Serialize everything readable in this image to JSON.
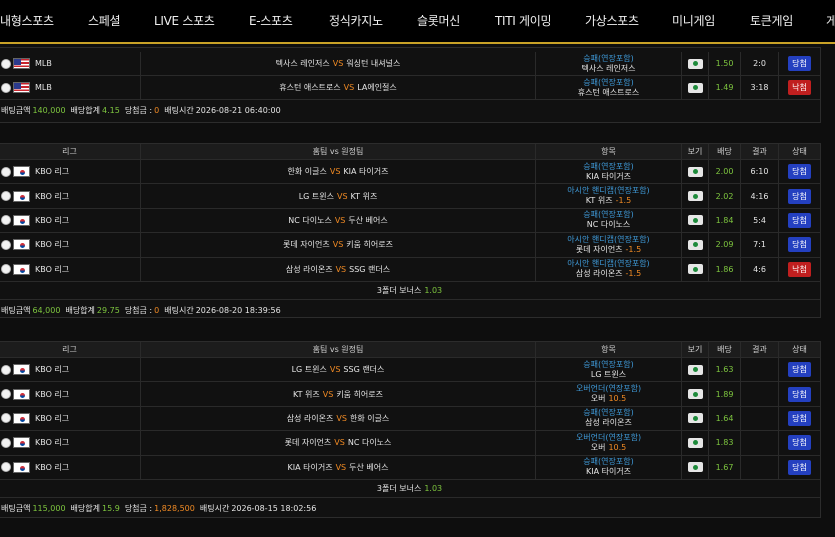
{
  "nav": [
    "내형스포츠",
    "스페셜",
    "LIVE 스포츠",
    "E-스포츠",
    "정식카지노",
    "슬롯머신",
    "TITI 게이밍",
    "가상스포츠",
    "미니게임",
    "토큰게임",
    "게"
  ],
  "labels": {
    "col_league": "리그",
    "col_match": "홈팀 vs 원정팀",
    "col_pick": "항목",
    "col_view": "보기",
    "col_odds": "배당",
    "col_result": "결과",
    "col_status": "상태",
    "vs": "VS",
    "bet_amount": "배팅금액",
    "total_odds": "배당합계",
    "payout": "당첨금 :",
    "bet_time": "배팅시간",
    "bonus": "3폴더 보너스"
  },
  "bets": [
    {
      "rows": [
        {
          "flag": "us",
          "league": "MLB",
          "home": "텍사스 레인저스",
          "away": "워싱턴 내셔널스",
          "pick_top": "승패(연장포함)",
          "pick_hcp": "",
          "pick_bottom": "텍사스 레인저스",
          "odds": "1.50",
          "result": "2:0",
          "status": "당첨",
          "status_type": "win"
        },
        {
          "flag": "us",
          "league": "MLB",
          "home": "휴스턴 애스트로스",
          "away": "LA에인절스",
          "pick_top": "승패(연장포함)",
          "pick_hcp": "",
          "pick_bottom": "휴스턴 애스트로스",
          "odds": "1.49",
          "result": "3:18",
          "status": "낙첨",
          "status_type": "lose"
        }
      ],
      "bet_amount": "140,000",
      "total_odds": "4.15",
      "payout": "0",
      "bet_time": "2026-08-21 06:40:00"
    },
    {
      "rows": [
        {
          "flag": "kr",
          "league": "KBO 리그",
          "home": "한화 이글스",
          "away": "KIA 타이거즈",
          "pick_top": "승패(연장포함)",
          "pick_hcp": "",
          "pick_bottom": "KIA 타이거즈",
          "odds": "2.00",
          "result": "6:10",
          "status": "당첨",
          "status_type": "win"
        },
        {
          "flag": "kr",
          "league": "KBO 리그",
          "home": "LG 트윈스",
          "away": "KT 위즈",
          "pick_top": "아시안 핸디캡(연장포함)",
          "pick_hcp": "-1.5",
          "pick_bottom": "KT 위즈",
          "odds": "2.02",
          "result": "4:16",
          "status": "당첨",
          "status_type": "win"
        },
        {
          "flag": "kr",
          "league": "KBO 리그",
          "home": "NC 다이노스",
          "away": "두산 베어스",
          "pick_top": "승패(연장포함)",
          "pick_hcp": "",
          "pick_bottom": "NC 다이노스",
          "odds": "1.84",
          "result": "5:4",
          "status": "당첨",
          "status_type": "win"
        },
        {
          "flag": "kr",
          "league": "KBO 리그",
          "home": "롯데 자이언츠",
          "away": "키움 히어로즈",
          "pick_top": "아시안 핸디캡(연장포함)",
          "pick_hcp": "-1.5",
          "pick_bottom": "롯데 자이언츠",
          "odds": "2.09",
          "result": "7:1",
          "status": "당첨",
          "status_type": "win"
        },
        {
          "flag": "kr",
          "league": "KBO 리그",
          "home": "삼성 라이온즈",
          "away": "SSG 랜더스",
          "pick_top": "아시안 핸디캡(연장포함)",
          "pick_hcp": "-1.5",
          "pick_bottom": "삼성 라이온즈",
          "odds": "1.86",
          "result": "4:6",
          "status": "낙첨",
          "status_type": "lose"
        }
      ],
      "bonus_value": "1.03",
      "bet_amount": "64,000",
      "total_odds": "29.75",
      "payout": "0",
      "bet_time": "2026-08-20 18:39:56"
    },
    {
      "rows": [
        {
          "flag": "kr",
          "league": "KBO 리그",
          "home": "LG 트윈스",
          "away": "SSG 랜더스",
          "pick_top": "승패(연장포함)",
          "pick_hcp": "",
          "pick_bottom": "LG 트윈스",
          "odds": "1.63",
          "result": "",
          "status": "당첨",
          "status_type": "win"
        },
        {
          "flag": "kr",
          "league": "KBO 리그",
          "home": "KT 위즈",
          "away": "키움 히어로즈",
          "pick_top": "오버언더(연장포함)",
          "pick_hcp": "10.5",
          "pick_bottom": "오버",
          "odds": "1.89",
          "result": "",
          "status": "당첨",
          "status_type": "win"
        },
        {
          "flag": "kr",
          "league": "KBO 리그",
          "home": "삼성 라이온즈",
          "away": "한화 이글스",
          "pick_top": "승패(연장포함)",
          "pick_hcp": "",
          "pick_bottom": "삼성 라이온즈",
          "odds": "1.64",
          "result": "",
          "status": "당첨",
          "status_type": "win"
        },
        {
          "flag": "kr",
          "league": "KBO 리그",
          "home": "롯데 자이언츠",
          "away": "NC 다이노스",
          "pick_top": "오버언더(연장포함)",
          "pick_hcp": "10.5",
          "pick_bottom": "오버",
          "odds": "1.83",
          "result": "",
          "status": "당첨",
          "status_type": "win"
        },
        {
          "flag": "kr",
          "league": "KBO 리그",
          "home": "KIA 타이거즈",
          "away": "두산 베어스",
          "pick_top": "승패(연장포함)",
          "pick_hcp": "",
          "pick_bottom": "KIA 타이거즈",
          "odds": "1.67",
          "result": "",
          "status": "당첨",
          "status_type": "win"
        }
      ],
      "bonus_value": "1.03",
      "bet_amount": "115,000",
      "total_odds": "15.9",
      "payout": "1,828,500",
      "bet_time": "2026-08-15 18:02:56"
    }
  ]
}
